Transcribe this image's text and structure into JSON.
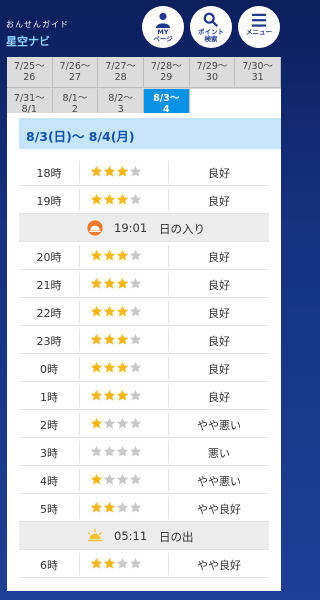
{
  "header": {
    "logo_sub": "おんせんガイド",
    "logo_main": "星空ナビ",
    "my_label": "MY\nページ",
    "point_label": "ポイント\n検索",
    "menu_label": "メニュー"
  },
  "tabs": [
    {
      "label": "7/25〜\n26",
      "active": false
    },
    {
      "label": "7/26〜\n27",
      "active": false
    },
    {
      "label": "7/27〜\n28",
      "active": false
    },
    {
      "label": "7/28〜\n29",
      "active": false
    },
    {
      "label": "7/29〜\n30",
      "active": false
    },
    {
      "label": "7/30〜\n31",
      "active": false
    },
    {
      "label": "7/31〜\n8/1",
      "active": false
    },
    {
      "label": "8/1〜\n2",
      "active": false
    },
    {
      "label": "8/2〜\n3",
      "active": false
    },
    {
      "label": "8/3〜\n4",
      "active": true
    }
  ],
  "date_header": "8/3(日)〜 8/4(月)",
  "rows": [
    {
      "type": "hour",
      "hour": "18時",
      "stars": 3,
      "cond": "良好"
    },
    {
      "type": "hour",
      "hour": "19時",
      "stars": 3,
      "cond": "良好"
    },
    {
      "type": "event",
      "icon": "sunset",
      "time": "19:01",
      "label": "日の入り"
    },
    {
      "type": "hour",
      "hour": "20時",
      "stars": 3,
      "cond": "良好"
    },
    {
      "type": "hour",
      "hour": "21時",
      "stars": 3,
      "cond": "良好"
    },
    {
      "type": "hour",
      "hour": "22時",
      "stars": 3,
      "cond": "良好"
    },
    {
      "type": "hour",
      "hour": "23時",
      "stars": 3,
      "cond": "良好"
    },
    {
      "type": "hour",
      "hour": "0時",
      "stars": 3,
      "cond": "良好"
    },
    {
      "type": "hour",
      "hour": "1時",
      "stars": 3,
      "cond": "良好"
    },
    {
      "type": "hour",
      "hour": "2時",
      "stars": 1,
      "cond": "やや悪い"
    },
    {
      "type": "hour",
      "hour": "3時",
      "stars": 0,
      "cond": "悪い"
    },
    {
      "type": "hour",
      "hour": "4時",
      "stars": 1,
      "cond": "やや悪い"
    },
    {
      "type": "hour",
      "hour": "5時",
      "stars": 2,
      "cond": "やや良好"
    },
    {
      "type": "event",
      "icon": "sunrise",
      "time": "05:11",
      "label": "日の出"
    },
    {
      "type": "hour",
      "hour": "6時",
      "stars": 2,
      "cond": "やや良好"
    }
  ],
  "colors": {
    "star_on": "#f2b81a",
    "star_off": "#c8c8c8",
    "active_tab": "#0a93e6"
  }
}
